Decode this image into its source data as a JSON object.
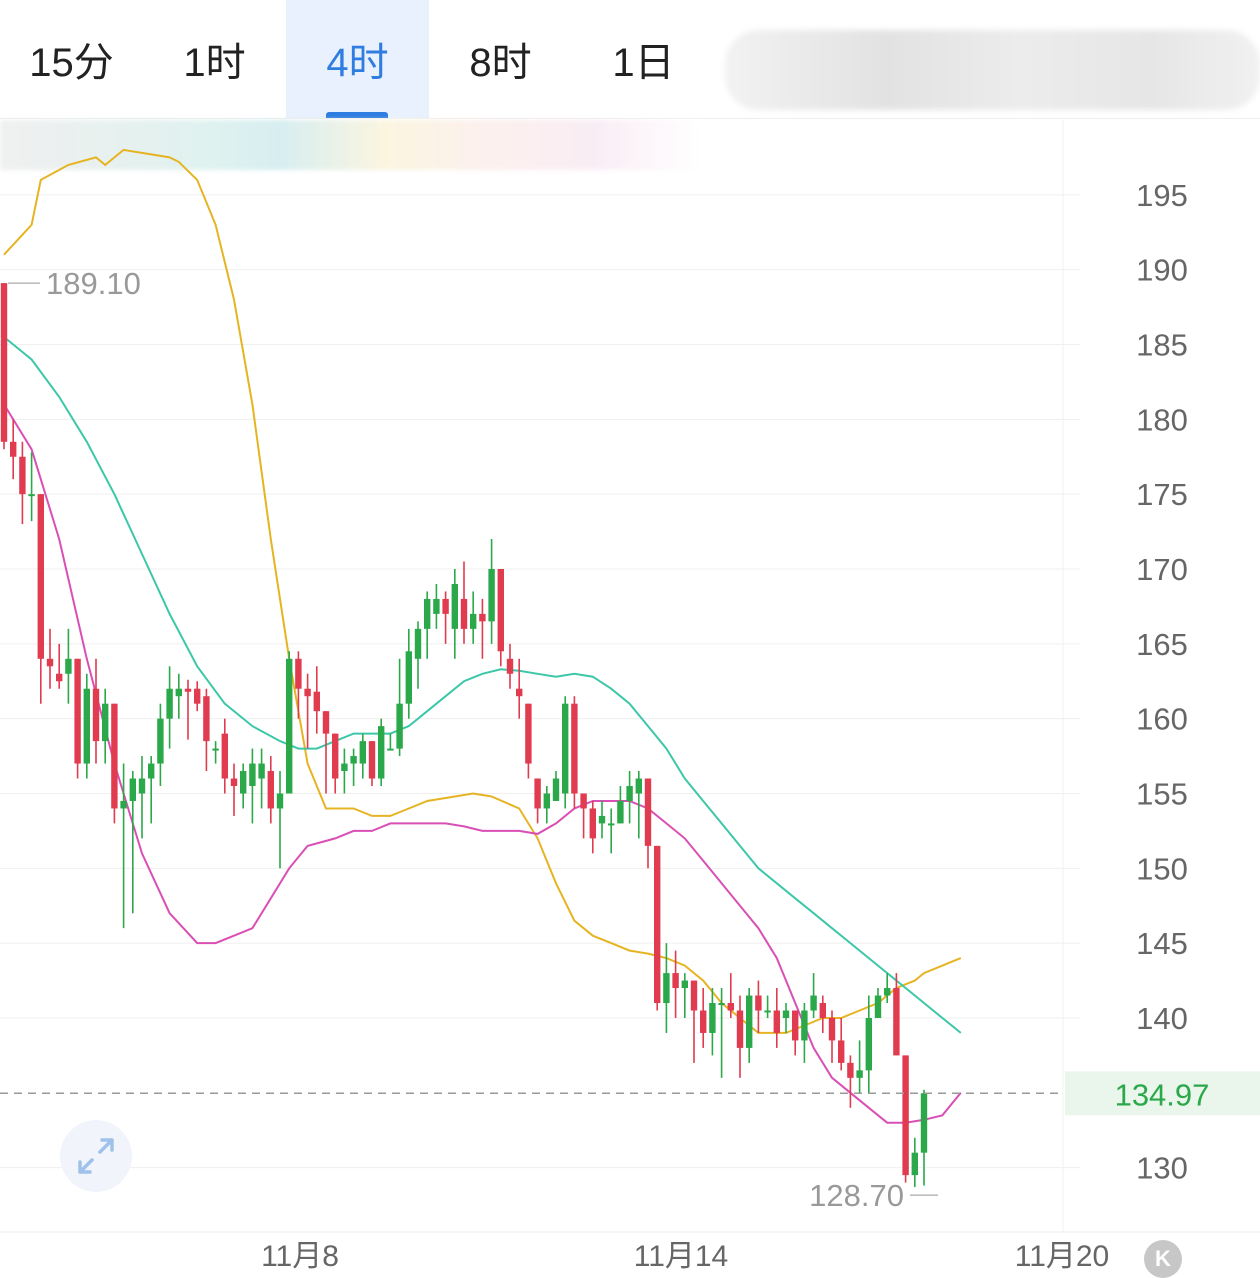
{
  "tabs": [
    {
      "label": "15分",
      "active": false
    },
    {
      "label": "1时",
      "active": false
    },
    {
      "label": "4时",
      "active": true
    },
    {
      "label": "8时",
      "active": false
    },
    {
      "label": "1日",
      "active": false
    }
  ],
  "colors": {
    "accent": "#2f7de1",
    "up": "#2ba84a",
    "down": "#e03b4f",
    "upper_band": "#e6b422",
    "mid_band": "#3cc7a8",
    "lower_band": "#d94fb5",
    "current_price_bg": "#eaf6ec"
  },
  "icons": {
    "expand": "expand-arrows-icon",
    "kline": "k-logo-icon"
  },
  "k_label": "K",
  "chart_data": {
    "type": "candlestick",
    "y_axis_ticks": [
      "195",
      "190",
      "185",
      "180",
      "175",
      "170",
      "165",
      "160",
      "155",
      "150",
      "145",
      "140",
      "130"
    ],
    "ylim": [
      125.7,
      200.0
    ],
    "x_axis_labels": [
      "11月8",
      "11月14",
      "11月20"
    ],
    "current_price": "134.97",
    "max_marker": "189.10",
    "min_marker": "128.70",
    "grid": true,
    "candles": [
      [
        189.1,
        178.5,
        189.1,
        178
      ],
      [
        178.5,
        177.5,
        180,
        176
      ],
      [
        177.5,
        175,
        178.5,
        173
      ],
      [
        175,
        175,
        177.8,
        173.2
      ],
      [
        175,
        164,
        175,
        161
      ],
      [
        164,
        163.5,
        166,
        162
      ],
      [
        163,
        162.5,
        165,
        162
      ],
      [
        163,
        164,
        166,
        161
      ],
      [
        164,
        157,
        164,
        156
      ],
      [
        157,
        162,
        163,
        156
      ],
      [
        162,
        158.5,
        164,
        157
      ],
      [
        158.5,
        161,
        162,
        157
      ],
      [
        161,
        154,
        161,
        153
      ],
      [
        154,
        154.5,
        157,
        146
      ],
      [
        154.5,
        156,
        156.5,
        147
      ],
      [
        155,
        156,
        157.5,
        152
      ],
      [
        156,
        157,
        157.5,
        153
      ],
      [
        157,
        160,
        161,
        155.5
      ],
      [
        160,
        162,
        163.5,
        158
      ],
      [
        161.5,
        162,
        163,
        160
      ],
      [
        162,
        161.8,
        162.6,
        158.6
      ],
      [
        162,
        161,
        162.5,
        160.5
      ],
      [
        161.5,
        158.5,
        162,
        156.5
      ],
      [
        158,
        158,
        158.5,
        157
      ],
      [
        159,
        156,
        160,
        155
      ],
      [
        156,
        155.5,
        157,
        153.5
      ],
      [
        155,
        156.5,
        157,
        154
      ],
      [
        155.5,
        157,
        158,
        153
      ],
      [
        156,
        157,
        158,
        154
      ],
      [
        156.5,
        154,
        157.5,
        153
      ],
      [
        154,
        155,
        156.5,
        150
      ],
      [
        155,
        164,
        164.5,
        155
      ],
      [
        164,
        162,
        164.5,
        160
      ],
      [
        162,
        161.5,
        163,
        158
      ],
      [
        161.8,
        160.5,
        163.5,
        159
      ],
      [
        160.5,
        159,
        160.5,
        155
      ],
      [
        159,
        156,
        159,
        155
      ],
      [
        156.5,
        157,
        158,
        155
      ],
      [
        157,
        157.5,
        158,
        155.5
      ],
      [
        157,
        158.5,
        159,
        156
      ],
      [
        158.5,
        156,
        158.5,
        155.5
      ],
      [
        156,
        159.5,
        160,
        155.5
      ],
      [
        158,
        158,
        159,
        158
      ],
      [
        158,
        161,
        164,
        157.5
      ],
      [
        161,
        164.5,
        166,
        160
      ],
      [
        164,
        166,
        166.5,
        162
      ],
      [
        166,
        168,
        168.5,
        164
      ],
      [
        167,
        168,
        169,
        166
      ],
      [
        168,
        167,
        168.5,
        165
      ],
      [
        166,
        169,
        170,
        164
      ],
      [
        168,
        166,
        170.5,
        165
      ],
      [
        166,
        167,
        168.5,
        165
      ],
      [
        167,
        166.5,
        168,
        164
      ],
      [
        166.5,
        170,
        172,
        165
      ],
      [
        170,
        164.5,
        170,
        163.5
      ],
      [
        164,
        163,
        165,
        162
      ],
      [
        162,
        161.5,
        164,
        160
      ],
      [
        161,
        157,
        161,
        156
      ],
      [
        156,
        154,
        156,
        153
      ],
      [
        154,
        155,
        155.5,
        153
      ],
      [
        154.5,
        156,
        156.5,
        154.5
      ],
      [
        155,
        161,
        161.5,
        154
      ],
      [
        161,
        155,
        161.5,
        154
      ],
      [
        155,
        154,
        155,
        152
      ],
      [
        154,
        152,
        154.5,
        151
      ],
      [
        153,
        153.5,
        154.5,
        152
      ],
      [
        153,
        153,
        154,
        151
      ],
      [
        153,
        154.5,
        155.5,
        153
      ],
      [
        154.5,
        155.5,
        156.5,
        153
      ],
      [
        155,
        156,
        156.5,
        152
      ],
      [
        156,
        151.5,
        156,
        150
      ],
      [
        151.5,
        141,
        151.5,
        140.5
      ],
      [
        141,
        143,
        145,
        139
      ],
      [
        143,
        142,
        144.5,
        140
      ],
      [
        142,
        142.5,
        143,
        140
      ],
      [
        142.5,
        140.5,
        142.5,
        137
      ],
      [
        140.5,
        139,
        142,
        138
      ],
      [
        139,
        141,
        142,
        137.5
      ],
      [
        141,
        141,
        142,
        136
      ],
      [
        141,
        140.5,
        143,
        140
      ],
      [
        140.5,
        138,
        141.5,
        136
      ],
      [
        138,
        141.5,
        142,
        137
      ],
      [
        141.5,
        140.5,
        142.5,
        139
      ],
      [
        140.5,
        140.5,
        141.5,
        140
      ],
      [
        140.5,
        139,
        142,
        138
      ],
      [
        140,
        140.5,
        141,
        139
      ],
      [
        140.5,
        138.5,
        140.5,
        137.5
      ],
      [
        138.5,
        140.5,
        141,
        137
      ],
      [
        140.5,
        141.5,
        143,
        140
      ],
      [
        141,
        140,
        141.5,
        139
      ],
      [
        140,
        138.5,
        140.5,
        137
      ],
      [
        138.5,
        137,
        140,
        136.5
      ],
      [
        137,
        136,
        137.5,
        134
      ],
      [
        136,
        136.5,
        138.5,
        135
      ],
      [
        136.5,
        140,
        141.5,
        135
      ],
      [
        140,
        141.5,
        142,
        140
      ],
      [
        141.5,
        142,
        143,
        141
      ],
      [
        142,
        137.5,
        143,
        137.5
      ],
      [
        137.5,
        129.5,
        137.5,
        129
      ],
      [
        129.5,
        131,
        132,
        128.7
      ],
      [
        131,
        134.97,
        135.2,
        128.8
      ]
    ],
    "upper_band": [
      [
        0,
        191
      ],
      [
        3,
        193
      ],
      [
        4,
        196
      ],
      [
        7,
        197
      ],
      [
        10,
        197.5
      ],
      [
        11,
        197
      ],
      [
        13,
        198
      ],
      [
        15,
        197.8
      ],
      [
        18,
        197.5
      ],
      [
        19,
        197.2
      ],
      [
        21,
        196
      ],
      [
        23,
        193
      ],
      [
        25,
        188
      ],
      [
        27,
        181
      ],
      [
        29,
        172
      ],
      [
        31,
        164
      ],
      [
        33,
        157
      ],
      [
        35,
        154
      ],
      [
        38,
        154
      ],
      [
        40,
        153.5
      ],
      [
        42,
        153.5
      ],
      [
        44,
        154
      ],
      [
        46,
        154.5
      ],
      [
        49,
        154.8
      ],
      [
        51,
        155
      ],
      [
        53,
        154.8
      ],
      [
        56,
        154
      ],
      [
        58,
        152
      ],
      [
        60,
        149
      ],
      [
        62,
        146.5
      ],
      [
        64,
        145.5
      ],
      [
        66,
        145
      ],
      [
        68,
        144.5
      ],
      [
        70,
        144.3
      ],
      [
        72,
        144
      ],
      [
        74,
        143.5
      ],
      [
        76,
        142.5
      ],
      [
        78,
        141
      ],
      [
        80,
        140
      ],
      [
        81,
        139.5
      ],
      [
        82,
        139
      ],
      [
        85,
        139
      ],
      [
        87,
        139.5
      ],
      [
        89,
        140
      ],
      [
        91,
        140
      ],
      [
        93,
        140.5
      ],
      [
        95,
        141
      ],
      [
        97,
        142
      ],
      [
        99,
        142.5
      ],
      [
        100,
        143
      ],
      [
        102,
        143.5
      ],
      [
        104,
        144
      ]
    ],
    "mid_band": [
      [
        0,
        185.5
      ],
      [
        3,
        184
      ],
      [
        6,
        181.5
      ],
      [
        9,
        178.5
      ],
      [
        12,
        175
      ],
      [
        15,
        171
      ],
      [
        18,
        167
      ],
      [
        21,
        163.5
      ],
      [
        24,
        161
      ],
      [
        27,
        159.5
      ],
      [
        30,
        158.5
      ],
      [
        32,
        158
      ],
      [
        34,
        158
      ],
      [
        36,
        158.5
      ],
      [
        38,
        159
      ],
      [
        40,
        159
      ],
      [
        42,
        159
      ],
      [
        44,
        159.5
      ],
      [
        46,
        160.5
      ],
      [
        48,
        161.5
      ],
      [
        50,
        162.5
      ],
      [
        52,
        163
      ],
      [
        54,
        163.3
      ],
      [
        56,
        163.2
      ],
      [
        58,
        163
      ],
      [
        60,
        162.8
      ],
      [
        62,
        163
      ],
      [
        64,
        162.8
      ],
      [
        66,
        162
      ],
      [
        68,
        161
      ],
      [
        70,
        159.5
      ],
      [
        72,
        158
      ],
      [
        74,
        156
      ],
      [
        76,
        154.5
      ],
      [
        78,
        153
      ],
      [
        80,
        151.5
      ],
      [
        82,
        150
      ],
      [
        84,
        149
      ],
      [
        86,
        148
      ],
      [
        88,
        147
      ],
      [
        90,
        146
      ],
      [
        92,
        145
      ],
      [
        94,
        144
      ],
      [
        96,
        143
      ],
      [
        98,
        142
      ],
      [
        100,
        141
      ],
      [
        102,
        140
      ],
      [
        104,
        139
      ]
    ],
    "lower_band": [
      [
        0,
        181
      ],
      [
        3,
        178
      ],
      [
        6,
        172
      ],
      [
        9,
        164
      ],
      [
        12,
        157
      ],
      [
        15,
        151
      ],
      [
        18,
        147
      ],
      [
        21,
        145
      ],
      [
        23,
        145
      ],
      [
        25,
        145.5
      ],
      [
        27,
        146
      ],
      [
        29,
        148
      ],
      [
        31,
        150
      ],
      [
        33,
        151.5
      ],
      [
        36,
        152
      ],
      [
        38,
        152.5
      ],
      [
        40,
        152.5
      ],
      [
        42,
        153
      ],
      [
        44,
        153
      ],
      [
        46,
        153
      ],
      [
        48,
        153
      ],
      [
        50,
        152.8
      ],
      [
        52,
        152.5
      ],
      [
        54,
        152.5
      ],
      [
        56,
        152.5
      ],
      [
        58,
        152.3
      ],
      [
        60,
        153
      ],
      [
        62,
        154
      ],
      [
        64,
        154.5
      ],
      [
        66,
        154.5
      ],
      [
        68,
        154.5
      ],
      [
        70,
        154
      ],
      [
        72,
        153
      ],
      [
        74,
        152
      ],
      [
        76,
        150.5
      ],
      [
        78,
        149
      ],
      [
        80,
        147.5
      ],
      [
        82,
        146
      ],
      [
        84,
        144
      ],
      [
        86,
        141
      ],
      [
        88,
        138
      ],
      [
        90,
        136
      ],
      [
        92,
        135
      ],
      [
        94,
        134
      ],
      [
        96,
        133
      ],
      [
        98,
        133
      ],
      [
        100,
        133.2
      ],
      [
        102,
        133.5
      ],
      [
        104,
        135
      ]
    ]
  }
}
